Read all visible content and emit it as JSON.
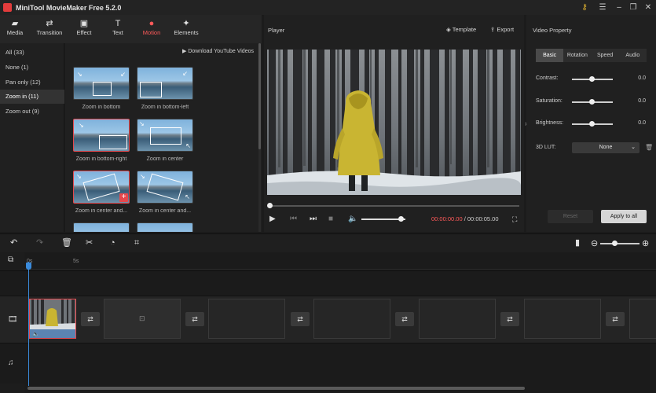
{
  "app": {
    "title": "MiniTool MovieMaker Free 5.2.0"
  },
  "window_buttons": [
    "key-icon",
    "menu-icon",
    "minimize-icon",
    "maximize-icon",
    "close-icon"
  ],
  "toolbar": {
    "items": [
      {
        "label": "Media",
        "icon": "folder-icon"
      },
      {
        "label": "Transition",
        "icon": "transition-icon"
      },
      {
        "label": "Effect",
        "icon": "effect-icon"
      },
      {
        "label": "Text",
        "icon": "text-icon"
      },
      {
        "label": "Motion",
        "icon": "motion-icon",
        "active": true
      },
      {
        "label": "Elements",
        "icon": "elements-icon"
      }
    ]
  },
  "categories": [
    {
      "label": "All (33)"
    },
    {
      "label": "None (1)"
    },
    {
      "label": "Pan only (12)"
    },
    {
      "label": "Zoom in (11)",
      "active": true
    },
    {
      "label": "Zoom out (9)"
    }
  ],
  "motion_panel": {
    "download_label": "Download YouTube Videos",
    "thumbnails": [
      {
        "label": "Zoom in bottom"
      },
      {
        "label": "Zoom in bottom-left"
      },
      {
        "label": "Zoom in bottom-right",
        "selected": true
      },
      {
        "label": "Zoom in center"
      },
      {
        "label": "Zoom in center and...",
        "selected": true
      },
      {
        "label": "Zoom in center and..."
      }
    ]
  },
  "player": {
    "title": "Player",
    "template_label": "Template",
    "export_label": "Export",
    "time_current": "00:00:00.00",
    "time_separator": " / ",
    "time_total": "00:00:05.00",
    "seek_progress": 0.0,
    "volume_level": 0.9
  },
  "properties": {
    "title": "Video Property",
    "tabs": [
      {
        "label": "Basic",
        "active": true
      },
      {
        "label": "Rotation"
      },
      {
        "label": "Speed"
      },
      {
        "label": "Audio"
      }
    ],
    "sliders": [
      {
        "label": "Contrast:",
        "value": "0.0"
      },
      {
        "label": "Saturation:",
        "value": "0.0"
      },
      {
        "label": "Brightness:",
        "value": "0.0"
      }
    ],
    "lut_label": "3D LUT:",
    "lut_value": "None",
    "reset_label": "Reset",
    "apply_label": "Apply to all"
  },
  "timeline": {
    "ruler": [
      "0s",
      "5s"
    ],
    "zoom_level": 0.35
  },
  "colors": {
    "accent": "#ff5a5a",
    "playhead": "#3a8bdc",
    "selection": "#e5484d"
  }
}
